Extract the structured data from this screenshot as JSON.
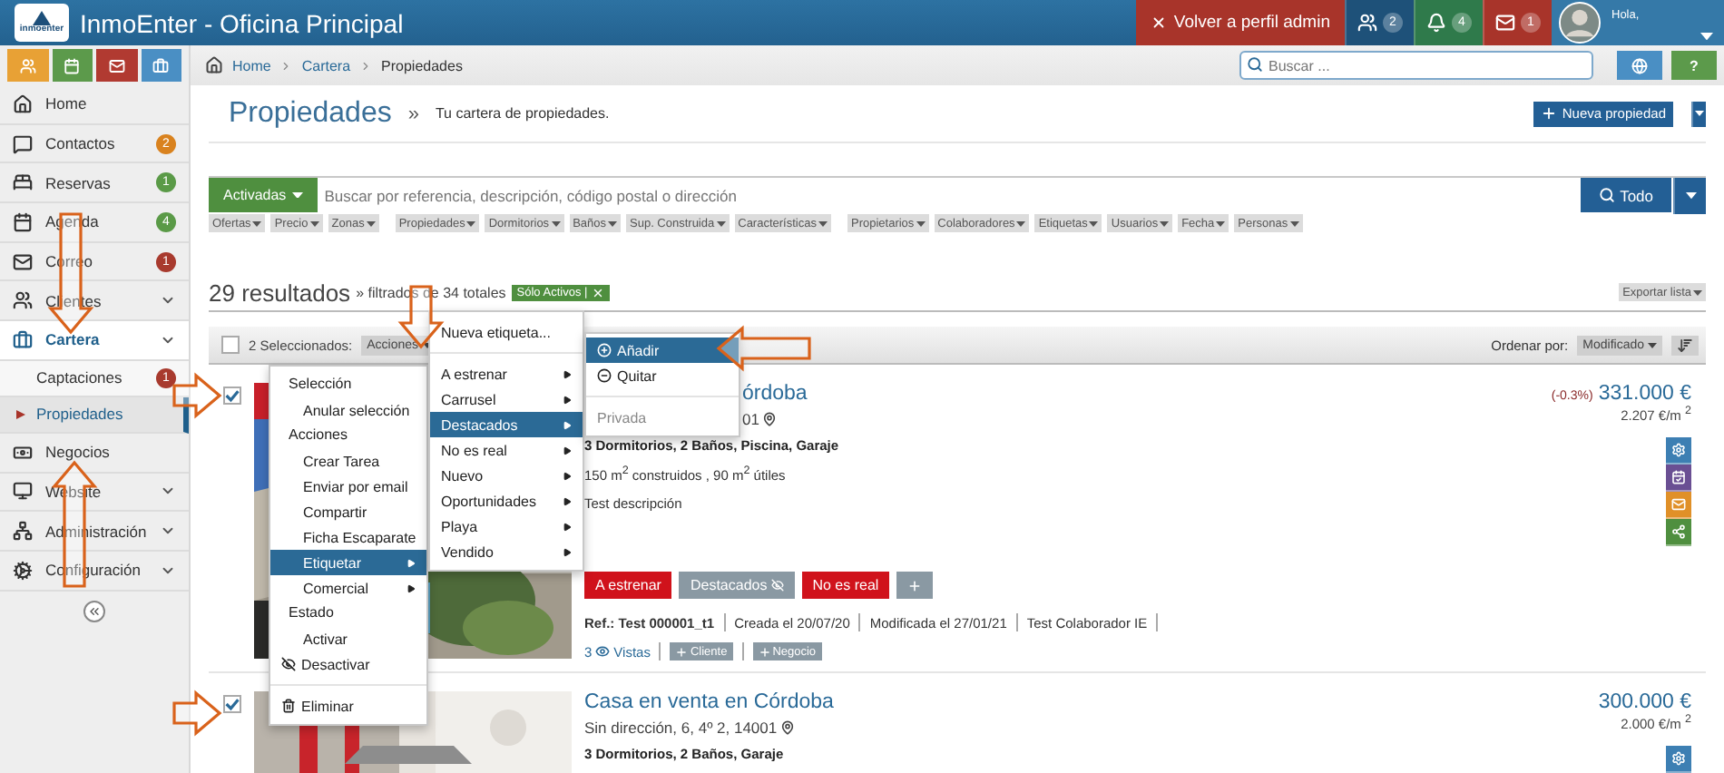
{
  "header": {
    "logo_text": "inmoenter",
    "title": "InmoEnter - Oficina Principal",
    "admin_button": "Volver a perfil admin",
    "notifications": [
      {
        "count": "2",
        "color": "#1e5179"
      },
      {
        "count": "4",
        "color": "#2f7a4b"
      },
      {
        "count": "1",
        "color": "#a8342a"
      }
    ],
    "user": {
      "greeting": "Hola,"
    }
  },
  "quick_buttons": [
    {
      "color": "#e8a135"
    },
    {
      "color": "#5c9a4b"
    },
    {
      "color": "#b13a31"
    },
    {
      "color": "#4a8fc4"
    }
  ],
  "sidebar": {
    "items": [
      {
        "label": "Home",
        "selected": false
      },
      {
        "label": "Contactos",
        "badge": "2",
        "color": "#d9821e",
        "selected": false
      },
      {
        "label": "Reservas",
        "badge": "1",
        "color": "#5a9a47",
        "selected": false
      },
      {
        "label": "Agenda",
        "badge": "4",
        "color": "#5a9a47",
        "selected": false
      },
      {
        "label": "Correo",
        "badge": "1",
        "color": "#a83a2e",
        "selected": false
      },
      {
        "label": "Clientes",
        "has_submenu": true,
        "selected": false
      },
      {
        "label": "Cartera",
        "has_submenu": true,
        "selected": true,
        "children": [
          {
            "label": "Captaciones",
            "badge": "1",
            "color": "#a83a2e",
            "selected": false
          },
          {
            "label": "Propiedades",
            "selected": true
          }
        ]
      },
      {
        "label": "Negocios",
        "selected": false
      },
      {
        "label": "Website",
        "has_submenu": true,
        "selected": false
      },
      {
        "label": "Administración",
        "has_submenu": true,
        "selected": false
      },
      {
        "label": "Configuración",
        "has_submenu": true,
        "selected": false
      }
    ]
  },
  "breadcrumb": [
    "Home",
    "Cartera",
    "Propiedades"
  ],
  "search": {
    "placeholder": "Buscar ..."
  },
  "help_button": "?",
  "page": {
    "title": "Propiedades",
    "separator": "»",
    "subtitle": "Tu cartera de propiedades.",
    "new_button": "Nueva propiedad"
  },
  "search_bar": {
    "status": "Activadas",
    "placeholder": "Buscar por referencia, descripción, código postal o dirección",
    "button": "Todo"
  },
  "filters": [
    [
      "Ofertas",
      "Precio",
      "Zonas"
    ],
    [
      "Propiedades",
      "Dormitorios",
      "Baños",
      "Sup. Construida",
      "Características"
    ],
    [
      "Propietarios",
      "Colaboradores",
      "Etiquetas",
      "Usuarios",
      "Fecha",
      "Personas"
    ]
  ],
  "results": {
    "count": "29 resultados",
    "filtered": "» filtrados de 34 totales",
    "chip": "Sólo Activos |",
    "export": "Exportar lista"
  },
  "toolbar": {
    "checked": false,
    "selected_text": "2 Seleccionados:",
    "actions": "Acciones",
    "sort_label": "Ordenar por:",
    "sort_value": "Modificado"
  },
  "listings": [
    {
      "checked": true,
      "title": "órdoba",
      "address": "01",
      "features": "3 Dormitorios, 2 Baños, Piscina, Garaje",
      "areas": "150 m$^{2}$ construidos , 90 m$^{2}$ útiles",
      "description": "Test descripción",
      "tags": [
        {
          "label": "A estrenar",
          "color": "#d0121b"
        },
        {
          "label": "Destacados",
          "color": "#8a99a3"
        },
        {
          "label": "No es real",
          "color": "#d0121b"
        }
      ],
      "meta": [
        "Ref.: Test 000001_t1",
        "Creada el 20/07/20",
        "Modificada el 27/01/21",
        "Test Colaborador IE"
      ],
      "views": "3",
      "views_label": "Vistas",
      "add_client": "Cliente",
      "add_deal": "Negocio",
      "change": "(-0.3%)",
      "price": "331.000 €",
      "price_m2": "2.207 €/m $^{2}$"
    },
    {
      "checked": true,
      "title": "Casa en venta en Córdoba",
      "address": "Sin dirección, 6, 4º 2, 14001",
      "features": "3 Dormitorios, 2 Baños, Garaje",
      "price": "300.000 €",
      "price_m2": "2.000 €/m $^{2}$"
    }
  ],
  "menus": [
    {
      "items": [
        {
          "kind": "header",
          "label": "Selección"
        },
        {
          "kind": "item",
          "label": "Anular selección",
          "selected": false
        },
        {
          "kind": "header",
          "label": "Acciones"
        },
        {
          "kind": "item",
          "label": "Crear Tarea",
          "selected": false
        },
        {
          "kind": "item",
          "label": "Enviar por email",
          "selected": false
        },
        {
          "kind": "item",
          "label": "Compartir",
          "selected": false
        },
        {
          "kind": "item",
          "label": "Ficha Escaparate",
          "selected": false
        },
        {
          "kind": "item",
          "label": "Etiquetar",
          "submenu": true,
          "selected": true
        },
        {
          "kind": "item",
          "label": "Comercial",
          "submenu": true,
          "selected": false
        },
        {
          "kind": "header",
          "label": "Estado"
        },
        {
          "kind": "item",
          "label": "Activar",
          "selected": false
        },
        {
          "kind": "icon_item",
          "label": "Desactivar",
          "selected": false
        },
        {
          "kind": "divider"
        },
        {
          "kind": "icon_item",
          "label": "Eliminar",
          "selected": false
        }
      ]
    },
    {
      "items": [
        {
          "kind": "item",
          "label": "Nueva etiqueta...",
          "selected": false
        },
        {
          "kind": "divider"
        },
        {
          "kind": "item",
          "label": "A estrenar",
          "submenu": true,
          "selected": false
        },
        {
          "kind": "item",
          "label": "Carrusel",
          "submenu": true,
          "selected": false
        },
        {
          "kind": "item",
          "label": "Destacados",
          "submenu": true,
          "selected": true
        },
        {
          "kind": "item",
          "label": "No es real",
          "submenu": true,
          "selected": false
        },
        {
          "kind": "item",
          "label": "Nuevo",
          "submenu": true,
          "selected": false
        },
        {
          "kind": "item",
          "label": "Oportunidades",
          "submenu": true,
          "selected": false
        },
        {
          "kind": "item",
          "label": "Playa",
          "submenu": true,
          "selected": false
        },
        {
          "kind": "item",
          "label": "Vendido",
          "submenu": true,
          "selected": false
        }
      ]
    },
    {
      "items": [
        {
          "kind": "icon_item",
          "label": "Añadir",
          "selected": true
        },
        {
          "kind": "icon_item",
          "label": "Quitar",
          "selected": false
        },
        {
          "kind": "divider"
        },
        {
          "kind": "muted",
          "label": "Privada",
          "selected": false
        }
      ]
    }
  ]
}
